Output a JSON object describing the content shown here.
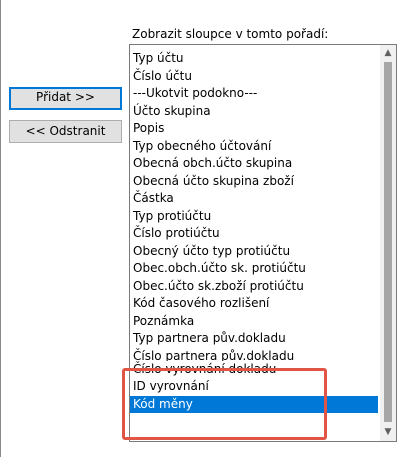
{
  "caption": "Zobrazit sloupce v tomto pořadí:",
  "buttons": {
    "add": "Přidat >>",
    "remove": "<< Odstranit"
  },
  "columns": [
    "Typ účtu",
    "Číslo účtu",
    "---Ukotvit podokno---",
    "Účto skupina",
    "Popis",
    "Typ obecného účtování",
    "Obecná obch.účto skupina",
    "Obecná účto skupina zboží",
    "Částka",
    "Typ protiúčtu",
    "Číslo protiúčtu",
    "Obecný účto typ protiúčtu",
    "Obec.obch.účto sk. protiúčtu",
    "Obec.účto sk.zboží protiúčtu",
    "Kód časového rozlišení",
    "Poznámka",
    "Typ partnera pův.dokladu",
    "Číslo partnera pův.dokladu",
    "Číslo vyrovnání dokladu",
    "ID vyrovnání",
    "Kód měny"
  ],
  "selected_column": "Kód měny",
  "scrollbar": {
    "up_icon": "▲",
    "down_icon": "▼"
  },
  "colors": {
    "selection": "#0078d7",
    "highlight": "#e05545"
  }
}
